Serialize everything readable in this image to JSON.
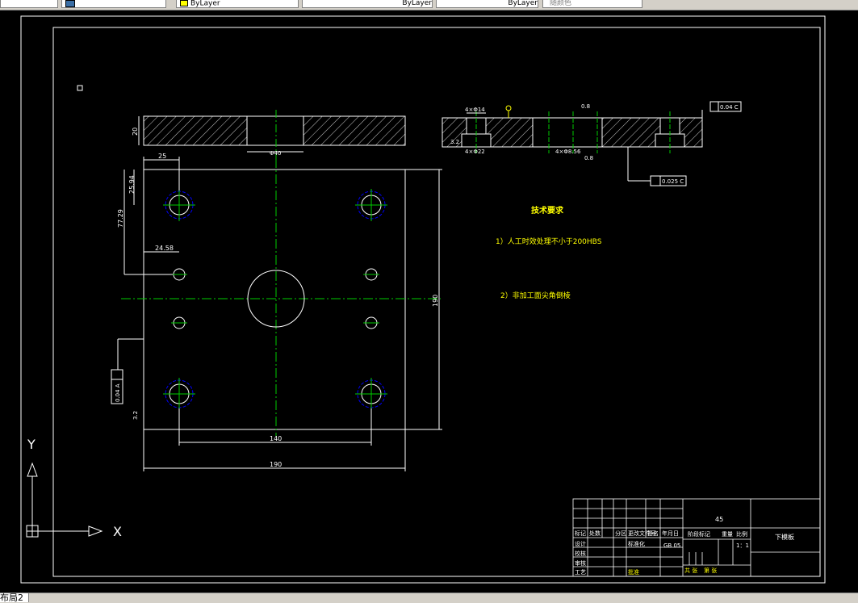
{
  "toolbar": {
    "layer_value": "ByLayer",
    "linetype_value": "ByLayer",
    "lineweight_value": "ByLayer",
    "plotstyle_value": "随颜色"
  },
  "drawing": {
    "tech_req_title": "技术要求",
    "tech_req_1": "1）人工时效处理不小于200HBS",
    "tech_req_2": "2）非加工面尖角倒棱",
    "dim_top_thickness": "20",
    "dim_top_bore": "Φ40",
    "dim_25": "25",
    "dim_25_94": "25.94",
    "dim_77_29": "77.29",
    "dim_24_58": "24.58",
    "dim_140": "140",
    "dim_190": "190",
    "dim_190_v": "190",
    "dim_3_2": "3.2",
    "gdt_left": "0.04 A",
    "gdt_top_right": "0.04 C",
    "gdt_parallel": "0.025 C",
    "sec_holes_top": "4×Φ14",
    "sec_holes_bottom": "4×Φ22",
    "sec_holes_mid": "4×Φ8.56",
    "sec_roughness_1": "3.2",
    "sec_roughness_2": "0.8",
    "sec_roughness_3": "0.8",
    "ucs_y": "Y",
    "ucs_x": "X"
  },
  "title_block": {
    "material": "45",
    "part_name": "下模板",
    "scale_label": "比例",
    "weight_label": "重量",
    "stage_label": "阶段标记",
    "scale_value": "1：1",
    "std": "GB 05",
    "r_mark": "标记",
    "r_count": "处数",
    "r_zone": "分区",
    "r_doc": "更改文件号",
    "r_sign": "签名",
    "r_date": "年月日",
    "r_design": "设计",
    "r_standard": "标准化",
    "r_check": "校核",
    "r_review": "审核",
    "r_process": "工艺",
    "r_approve": "批准",
    "r_sheets": "共 张",
    "r_sheet": "第 张"
  },
  "status": {
    "layout_tab": "布局2"
  }
}
